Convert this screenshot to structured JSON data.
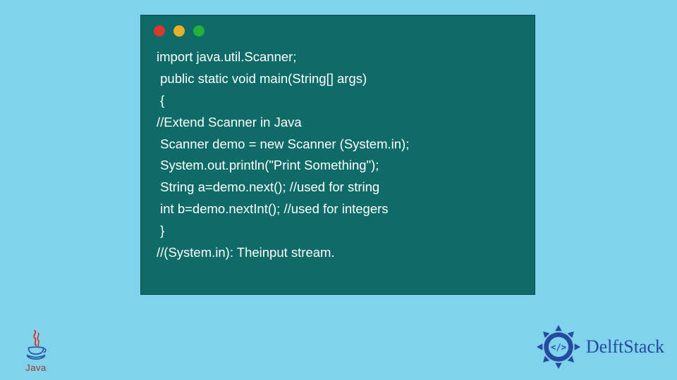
{
  "code_lines": [
    "import java.util.Scanner;",
    " public static void main(String[] args)",
    " {",
    "//Extend Scanner in Java",
    " Scanner demo = new Scanner (System.in);",
    " System.out.println(\"Print Something\");",
    " String a=demo.next(); //used for string",
    " int b=demo.nextInt(); //used for integers",
    " }",
    "//(System.in): Theinput stream."
  ],
  "java_logo_text": "Java",
  "delftstack_text": "DelftStack"
}
